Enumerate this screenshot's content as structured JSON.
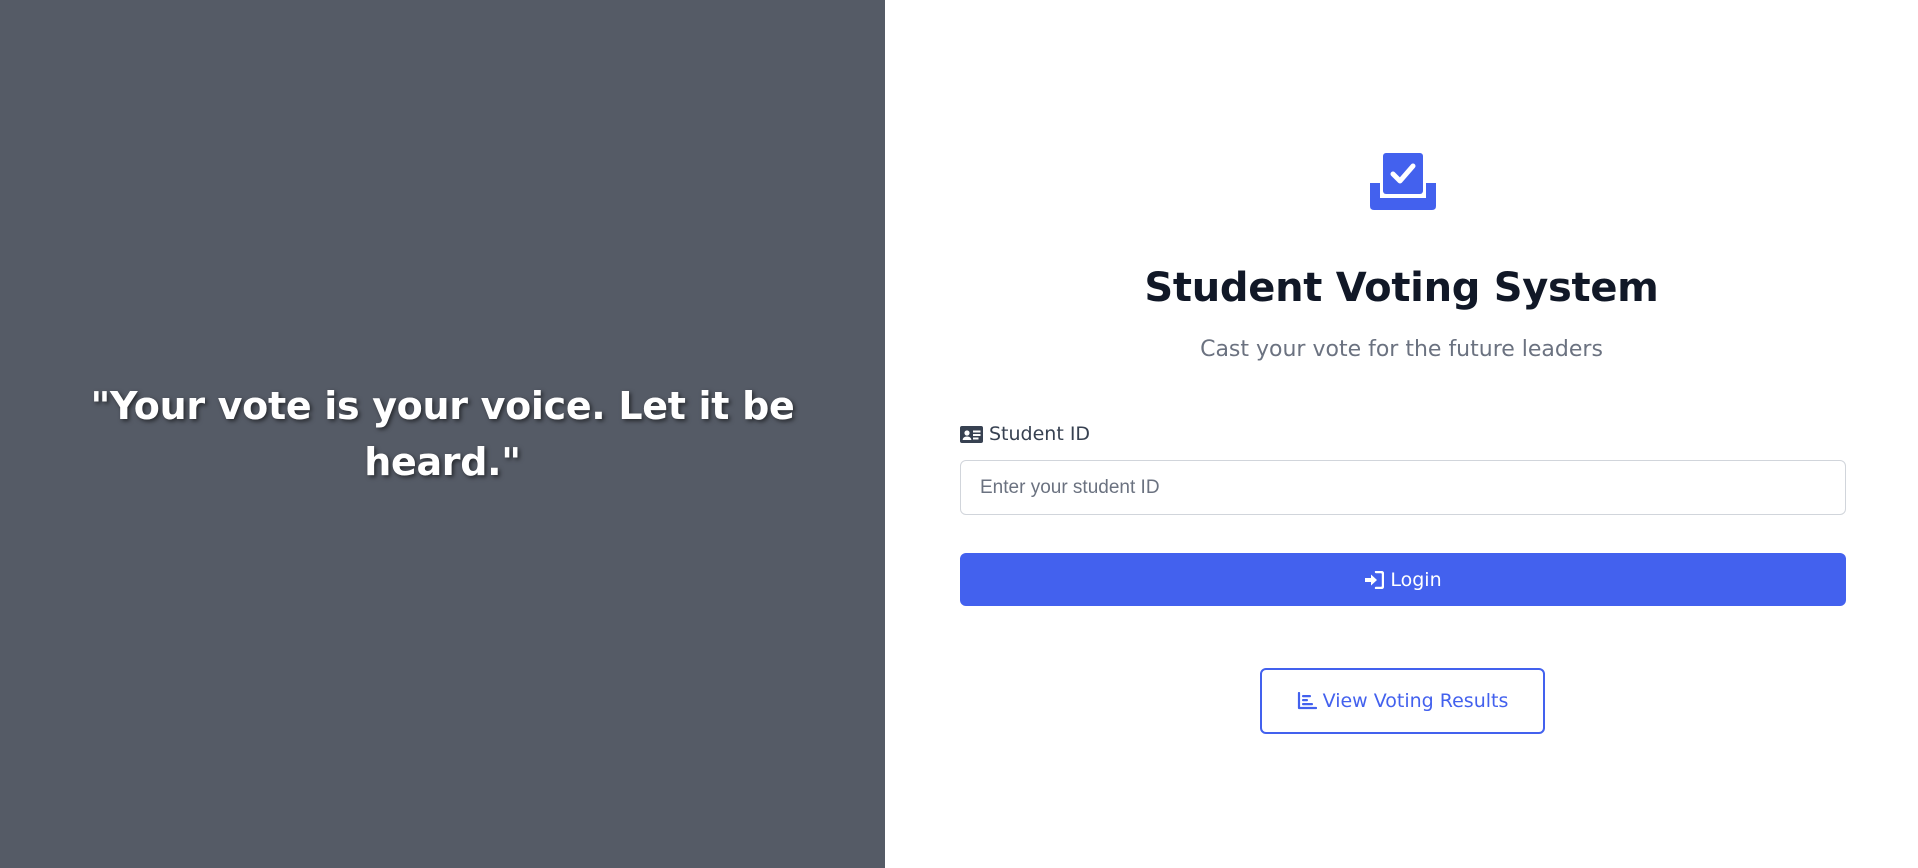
{
  "colors": {
    "left_panel_bg": "#555b66",
    "accent": "#4361ee",
    "title": "#111827",
    "subtitle": "#6b7280"
  },
  "quote_panel": {
    "quote": "\"Your vote is your voice. Let it be heard.\""
  },
  "login": {
    "logo_icon": "ballot-box-check-icon",
    "title": "Student Voting System",
    "subtitle": "Cast your vote for the future leaders",
    "student_id": {
      "icon": "id-card-icon",
      "label": "Student ID",
      "value": "",
      "placeholder": "Enter your student ID"
    },
    "login_button": {
      "icon": "sign-in-icon",
      "label": "Login"
    },
    "results_button": {
      "icon": "chart-bar-icon",
      "label": "View Voting Results"
    }
  }
}
